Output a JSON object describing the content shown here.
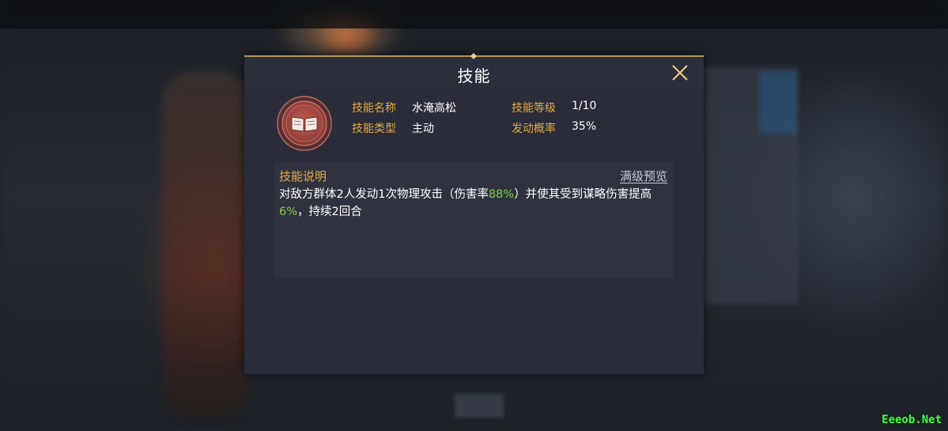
{
  "dialog": {
    "title": "技能",
    "close_icon": "close-x-icon",
    "skill_icon": "book-icon",
    "info": {
      "name_label": "技能名称",
      "name_value": "水淹高松",
      "level_label": "技能等级",
      "level_value": "1/10",
      "type_label": "技能类型",
      "type_value": "主动",
      "rate_label": "发动概率",
      "rate_value": "35%"
    },
    "description": {
      "title": "技能说明",
      "max_preview_link": "满级预览",
      "text_part1": "对敌方群体2人发动1次物理攻击（伤害率",
      "damage_rate": "88%",
      "text_part2": "）并使其受到谋略伤害提高",
      "increase_rate": "6%",
      "text_part3": "，持续2回合"
    }
  },
  "watermark": "Eeeob.Net",
  "colors": {
    "label_gold": "#e4ab44",
    "highlight_green": "#7fd04a",
    "dialog_bg": "#2a2c39",
    "icon_red": "#a0443e"
  }
}
